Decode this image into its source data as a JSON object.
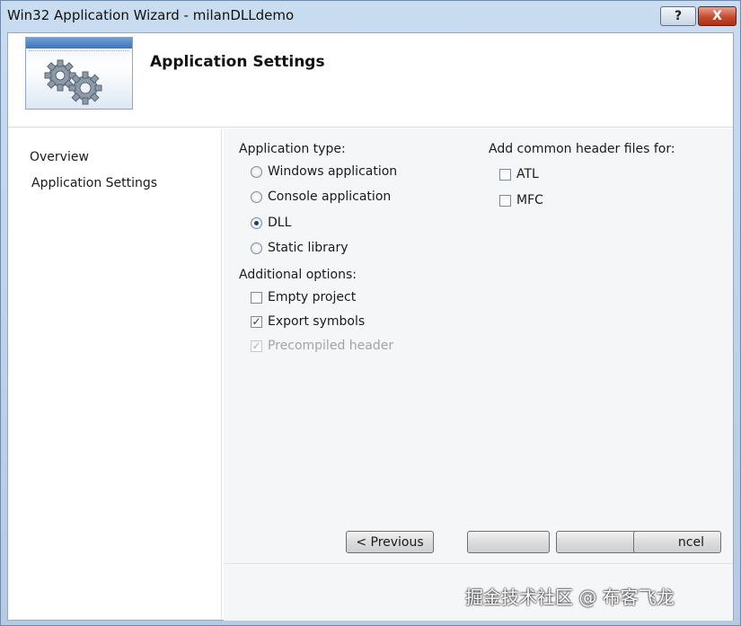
{
  "window": {
    "title": "Win32 Application Wizard - milanDLLdemo",
    "help_label": "?",
    "close_label": "X"
  },
  "banner": {
    "title": "Application Settings"
  },
  "nav": {
    "items": [
      {
        "label": "Overview",
        "selected": false
      },
      {
        "label": "Application Settings",
        "selected": true
      }
    ]
  },
  "application_type": {
    "label": "Application type:",
    "options": [
      {
        "label": "Windows application",
        "checked": false
      },
      {
        "label": "Console application",
        "checked": false
      },
      {
        "label": "DLL",
        "checked": true
      },
      {
        "label": "Static library",
        "checked": false
      }
    ]
  },
  "additional_options": {
    "label": "Additional options:",
    "options": [
      {
        "label": "Empty project",
        "checked": false,
        "enabled": true
      },
      {
        "label": "Export symbols",
        "checked": true,
        "enabled": true
      },
      {
        "label": "Precompiled header",
        "checked": true,
        "enabled": false
      }
    ]
  },
  "header_files": {
    "label": "Add common header files for:",
    "options": [
      {
        "label": "ATL",
        "checked": false
      },
      {
        "label": "MFC",
        "checked": false
      }
    ]
  },
  "buttons": {
    "previous": "< Previous",
    "next": "",
    "finish": "",
    "cancel": "ncel"
  },
  "watermark": "掘金技术社区 @ 布客飞龙",
  "colors": {
    "title_bar": "#c9dcf0",
    "close_button": "#c44a30",
    "content_background": "#f5f6f8"
  }
}
